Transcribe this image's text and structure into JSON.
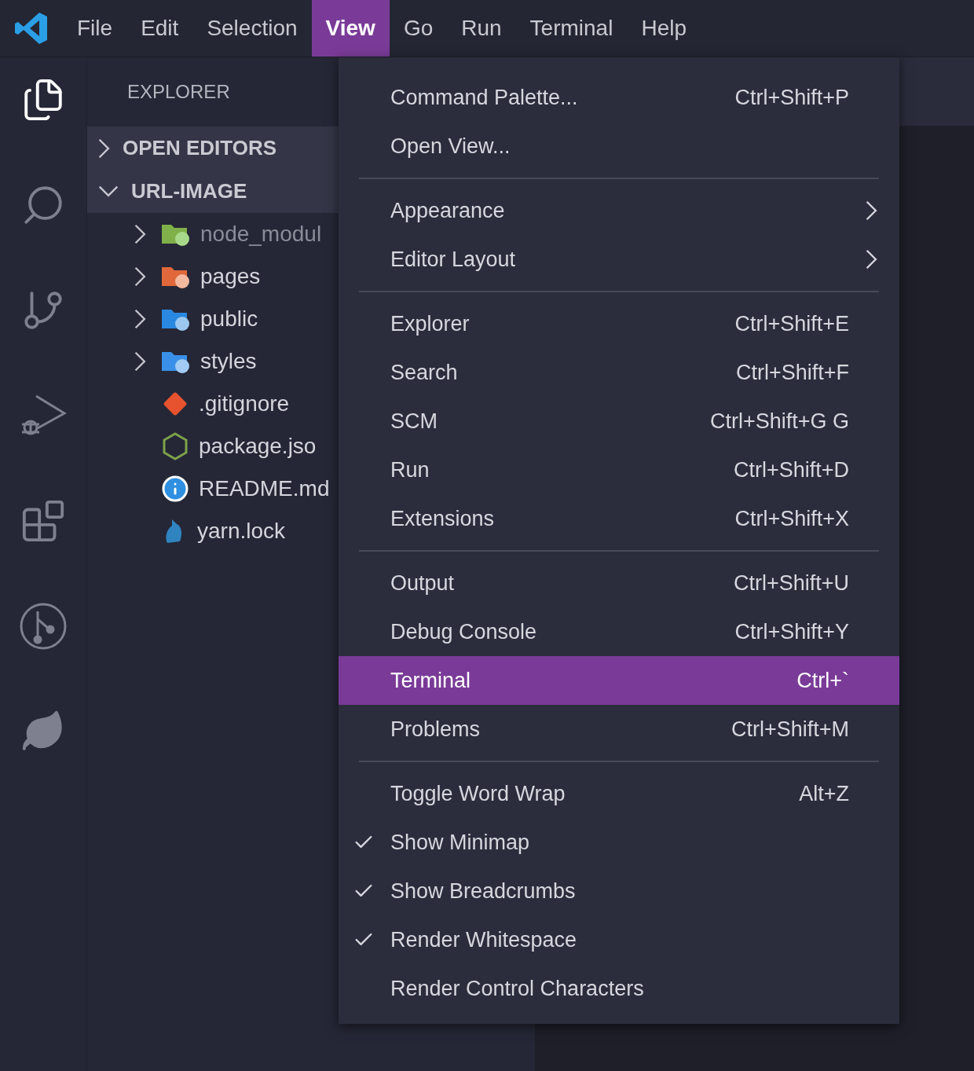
{
  "menubar": {
    "items": [
      {
        "label": "File",
        "selected": false
      },
      {
        "label": "Edit",
        "selected": false
      },
      {
        "label": "Selection",
        "selected": false
      },
      {
        "label": "View",
        "selected": true
      },
      {
        "label": "Go",
        "selected": false
      },
      {
        "label": "Run",
        "selected": false
      },
      {
        "label": "Terminal",
        "selected": false
      },
      {
        "label": "Help",
        "selected": false
      }
    ]
  },
  "activity_bar": {
    "items": [
      {
        "kind": "files",
        "selected": true
      },
      {
        "kind": "search",
        "selected": false
      },
      {
        "kind": "source-control",
        "selected": false
      },
      {
        "kind": "run-debug",
        "selected": false
      },
      {
        "kind": "extensions",
        "selected": false
      },
      {
        "kind": "git-graph",
        "selected": false
      },
      {
        "kind": "leaf",
        "selected": false
      }
    ]
  },
  "sidebar": {
    "title": "EXPLORER",
    "sections": [
      {
        "label": "OPEN EDITORS",
        "expanded": false
      },
      {
        "label": "URL-IMAGE",
        "expanded": true,
        "children": [
          {
            "name": "node_modul",
            "kind": "folder",
            "ignored": true
          },
          {
            "name": "pages",
            "kind": "folder",
            "ignored": false
          },
          {
            "name": "public",
            "kind": "folder",
            "ignored": false
          },
          {
            "name": "styles",
            "kind": "folder",
            "ignored": false
          },
          {
            "name": ".gitignore",
            "kind": "file",
            "ignored": false
          },
          {
            "name": "package.jso",
            "kind": "file",
            "ignored": false
          },
          {
            "name": "README.md",
            "kind": "file",
            "ignored": false
          },
          {
            "name": "yarn.lock",
            "kind": "file",
            "ignored": false
          }
        ]
      }
    ]
  },
  "view_menu": {
    "items": [
      {
        "kind": "item",
        "label": "Command Palette...",
        "shortcut": "Ctrl+Shift+P",
        "submenu": false,
        "checked": false,
        "selected": false
      },
      {
        "kind": "item",
        "label": "Open View...",
        "submenu": false,
        "checked": false,
        "selected": false
      },
      {
        "kind": "separator"
      },
      {
        "kind": "item",
        "label": "Appearance",
        "submenu": true,
        "checked": false,
        "selected": false
      },
      {
        "kind": "item",
        "label": "Editor Layout",
        "submenu": true,
        "checked": false,
        "selected": false
      },
      {
        "kind": "separator"
      },
      {
        "kind": "item",
        "label": "Explorer",
        "shortcut": "Ctrl+Shift+E",
        "submenu": false,
        "checked": false,
        "selected": false
      },
      {
        "kind": "item",
        "label": "Search",
        "shortcut": "Ctrl+Shift+F",
        "submenu": false,
        "checked": false,
        "selected": false
      },
      {
        "kind": "item",
        "label": "SCM",
        "shortcut": "Ctrl+Shift+G G",
        "submenu": false,
        "checked": false,
        "selected": false
      },
      {
        "kind": "item",
        "label": "Run",
        "shortcut": "Ctrl+Shift+D",
        "submenu": false,
        "checked": false,
        "selected": false
      },
      {
        "kind": "item",
        "label": "Extensions",
        "shortcut": "Ctrl+Shift+X",
        "submenu": false,
        "checked": false,
        "selected": false
      },
      {
        "kind": "separator"
      },
      {
        "kind": "item",
        "label": "Output",
        "shortcut": "Ctrl+Shift+U",
        "submenu": false,
        "checked": false,
        "selected": false
      },
      {
        "kind": "item",
        "label": "Debug Console",
        "shortcut": "Ctrl+Shift+Y",
        "submenu": false,
        "checked": false,
        "selected": false
      },
      {
        "kind": "item",
        "label": "Terminal",
        "shortcut": "Ctrl+`",
        "submenu": false,
        "checked": false,
        "selected": true
      },
      {
        "kind": "item",
        "label": "Problems",
        "shortcut": "Ctrl+Shift+M",
        "submenu": false,
        "checked": false,
        "selected": false
      },
      {
        "kind": "separator"
      },
      {
        "kind": "item",
        "label": "Toggle Word Wrap",
        "shortcut": "Alt+Z",
        "submenu": false,
        "checked": false,
        "selected": false
      },
      {
        "kind": "item",
        "label": "Show Minimap",
        "submenu": false,
        "checked": true,
        "selected": false
      },
      {
        "kind": "item",
        "label": "Show Breadcrumbs",
        "submenu": false,
        "checked": true,
        "selected": false
      },
      {
        "kind": "item",
        "label": "Render Whitespace",
        "submenu": false,
        "checked": true,
        "selected": false
      },
      {
        "kind": "item",
        "label": "Render Control Characters",
        "submenu": false,
        "checked": false,
        "selected": false
      }
    ]
  }
}
